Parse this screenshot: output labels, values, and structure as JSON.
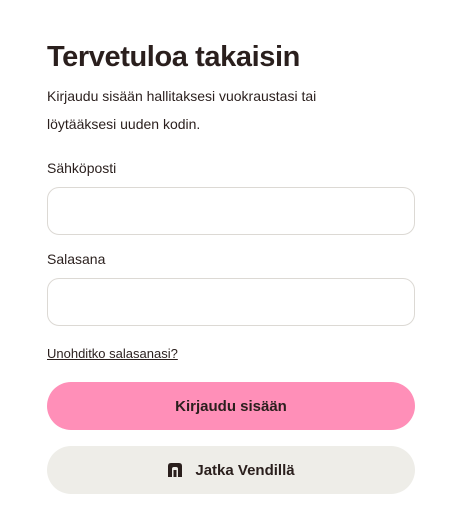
{
  "login": {
    "title": "Tervetuloa takaisin",
    "subtitle": "Kirjaudu sisään hallitaksesi vuokraustasi tai löytääksesi uuden kodin.",
    "email": {
      "label": "Sähköposti",
      "value": "",
      "placeholder": ""
    },
    "password": {
      "label": "Salasana",
      "value": "",
      "placeholder": ""
    },
    "forgot_password": "Unohditko salasanasi?",
    "submit_label": "Kirjaudu sisään",
    "vendi_label": "Jatka Vendillä",
    "vendi_icon": "vendi-logo-icon"
  },
  "colors": {
    "primary_button": "#ff8fb8",
    "secondary_button": "#eeede8",
    "text": "#2a1f1d",
    "input_border": "#dcd9d4"
  }
}
